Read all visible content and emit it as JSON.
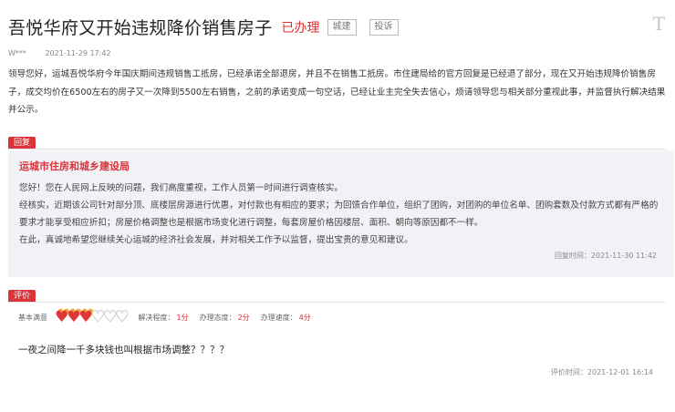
{
  "header": {
    "title": "吾悦华府又开始违规降价销售房子",
    "status": "已办理",
    "tags": [
      "城建",
      "投诉"
    ],
    "font_icon": "T"
  },
  "meta": {
    "user": "W***",
    "date": "2021-11-29 17:42"
  },
  "content": "领导您好，运城吾悦华府今年国庆期间违规销售工抵房，已经承诺全部退房，并且不在销售工抵房。市住建局给的官方回复是已经退了部分，现在又开始违规降价销售房子，成交均价在6500左右的房子又一次降到5500左右销售，之前的承诺变成一句空话，已经让业主完全失去信心，烦请领导您与相关部分重视此事，并监督执行解决结果并公示。",
  "reply": {
    "label": "回复",
    "org": "运城市住房和城乡建设局",
    "paragraphs": [
      "您好！您在人民网上反映的问题，我们高度重视，工作人员第一时间进行调查核实。",
      "经核实，近期该公司针对部分顶、底楼层房源进行优惠，对付款也有相应的要求；为回馈合作单位，组织了团购，对团购的单位名单、团购套数及付款方式都有严格的要求才能享受相应折扣；房屋价格调整也是根据市场变化进行调整，每套房屋价格因楼层、面积、朝向等原因都不一样。",
      "在此，真诚地希望您继续关心运城的经济社会发展，并对相关工作予以监督，提出宝贵的意见和建议。"
    ],
    "time": "回复时间：2021-11-30 11:42"
  },
  "evaluation": {
    "label": "评价",
    "basic_label": "基本满意",
    "hearts_filled": 3,
    "hearts_total": 6,
    "scores": [
      {
        "label": "解决程度：",
        "value": "1分"
      },
      {
        "label": "办理态度：",
        "value": "2分"
      },
      {
        "label": "办理速度：",
        "value": "4分"
      }
    ],
    "text": "一夜之间降一千多块钱也叫根据市场调整？？？？",
    "time": "评价时间：2021-12-01 16:14"
  },
  "colors": {
    "accent": "#d9343a",
    "reply_bg": "#f1f2f6"
  }
}
